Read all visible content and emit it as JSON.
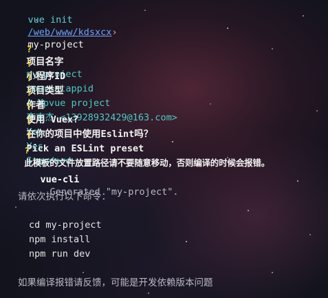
{
  "prompt": {
    "command": "vue init",
    "path": "/web/www/kdsxcx",
    "arrow": "›",
    "project": "my-project"
  },
  "questions": [
    {
      "mark": "?",
      "label": "项目名字",
      "answer": "my-project"
    },
    {
      "mark": "?",
      "label": "小程序ID",
      "answer": "touristappid"
    },
    {
      "mark": "?",
      "label": "项目类型",
      "answer": "A Mpvue project"
    },
    {
      "mark": "?",
      "label": "作者",
      "answer": "李志杰 <13928932429@163.com>"
    },
    {
      "mark": "?",
      "label": "使用 Vuex?",
      "answer": "Yes"
    },
    {
      "mark": "?",
      "label": "在你的项目中使用Eslint吗？",
      "answer": "Yes"
    },
    {
      "mark": "?",
      "label": "Pick an ESLint preset",
      "answer": "Standard"
    },
    {
      "mark": "?",
      "label": "此模板的文件放置路径请不要随意移动，否则编译的时候会报错。",
      "answer": ""
    }
  ],
  "generated": {
    "tool": "vue-cli",
    "message": "Generated \"my-project\"."
  },
  "instructions_title": "请依次执行以下命令：",
  "commands": [
    "cd my-project",
    "npm install",
    "npm run dev"
  ],
  "footer": "如果编译报错请反馈，可能是开发依赖版本问题",
  "colors": {
    "question_mark": "#f5d547",
    "answer": "#4fc9c3",
    "path": "#6ea3ff",
    "background": "#12131d"
  }
}
